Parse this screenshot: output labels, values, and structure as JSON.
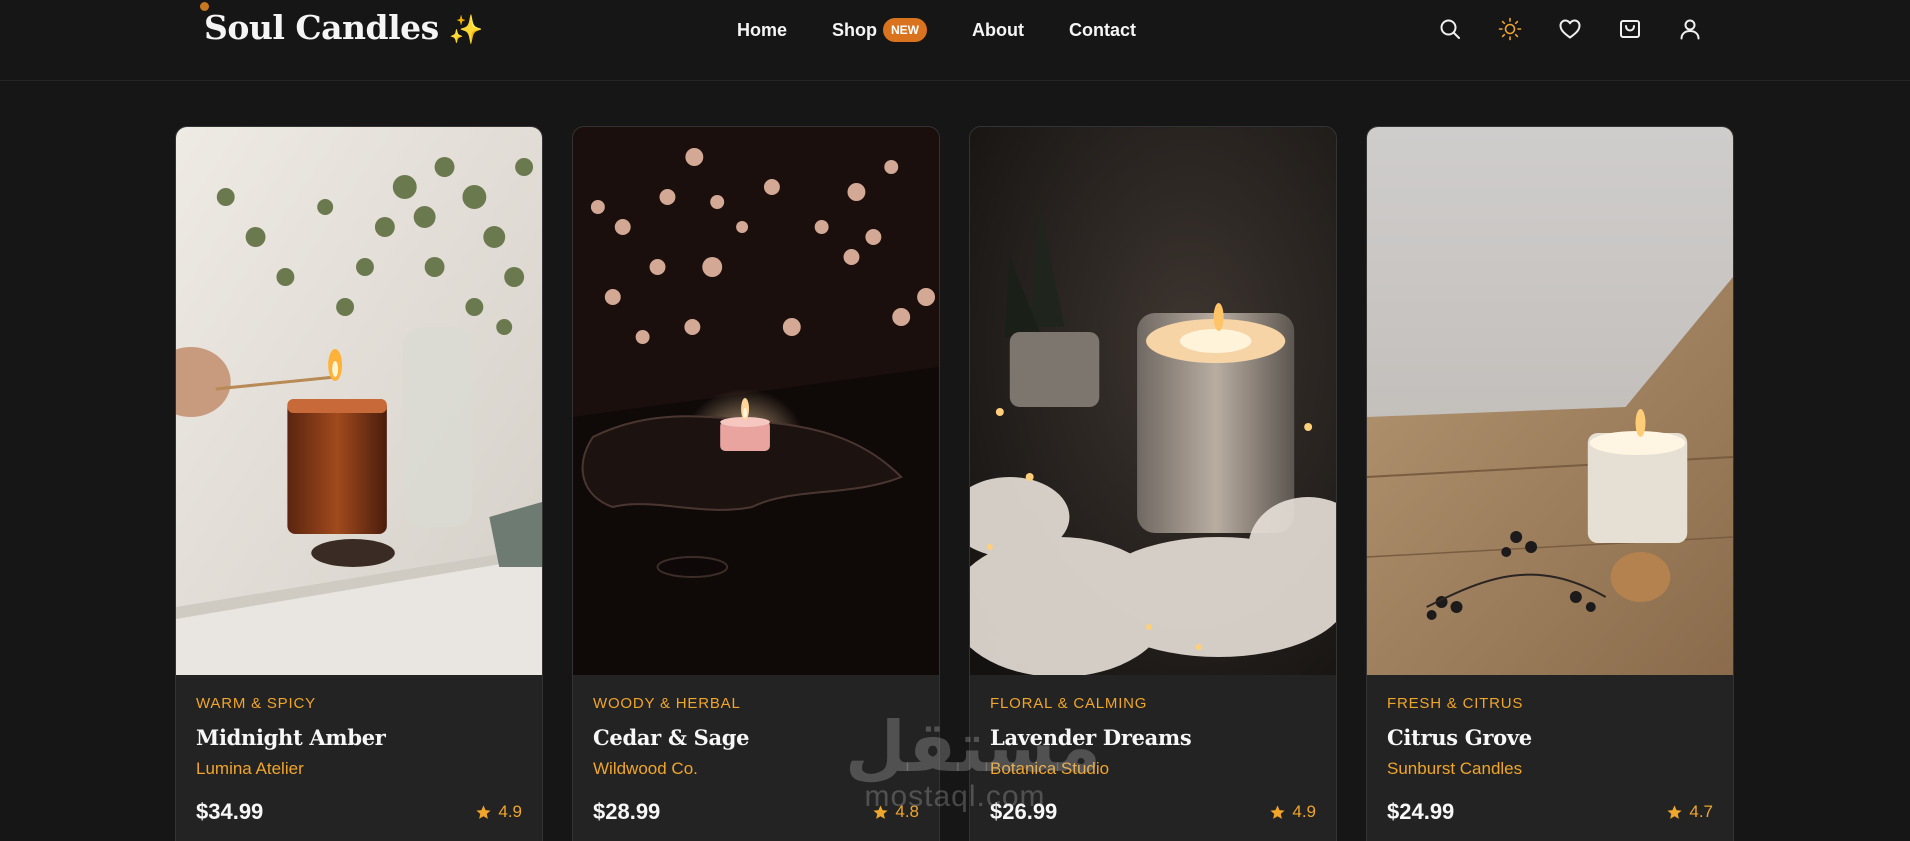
{
  "brand": {
    "name": "Soul Candles",
    "icon": "sparkles-icon",
    "accent": "#f0a52b"
  },
  "nav": {
    "home": "Home",
    "shop": "Shop",
    "shop_badge": "NEW",
    "about": "About",
    "contact": "Contact"
  },
  "toolbar_icons": [
    "search-icon",
    "sun-icon",
    "heart-icon",
    "bag-icon",
    "user-icon"
  ],
  "products": [
    {
      "category": "WARM & SPICY",
      "name": "Midnight Amber",
      "maker": "Lumina Atelier",
      "price": "$34.99",
      "rating": "4.9"
    },
    {
      "category": "WOODY & HERBAL",
      "name": "Cedar & Sage",
      "maker": "Wildwood Co.",
      "price": "$28.99",
      "rating": "4.8"
    },
    {
      "category": "FLORAL & CALMING",
      "name": "Lavender Dreams",
      "maker": "Botanica Studio",
      "price": "$26.99",
      "rating": "4.9"
    },
    {
      "category": "FRESH & CITRUS",
      "name": "Citrus Grove",
      "maker": "Sunburst Candles",
      "price": "$24.99",
      "rating": "4.7"
    }
  ],
  "watermark": {
    "arabic": "مستقل",
    "latin": "mostaql.com"
  }
}
